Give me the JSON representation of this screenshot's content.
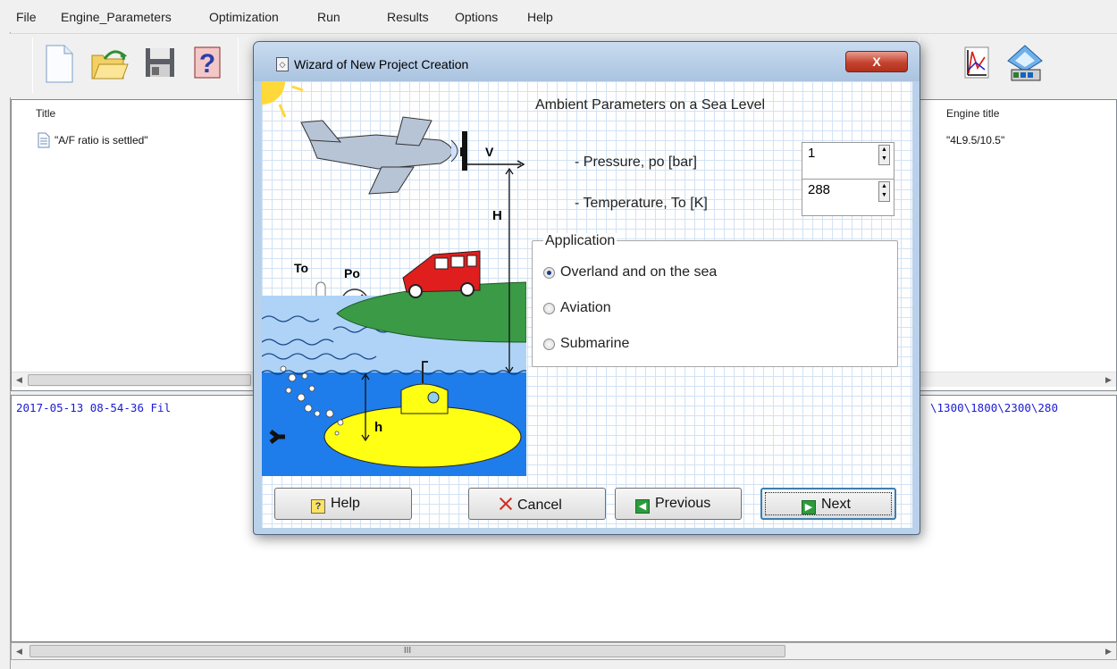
{
  "menu": [
    "File",
    "Engine_Parameters",
    "Optimization",
    "Run",
    "Results",
    "Options",
    "Help"
  ],
  "toolbar_icons": [
    "new-document-icon",
    "open-folder-icon",
    "save-disk-icon",
    "help-icon",
    "chart-icon",
    "video-icon"
  ],
  "list": {
    "columns": [
      "Title",
      "Engine title"
    ],
    "rows": [
      {
        "title": "\"A/F ratio is settled\"",
        "engine_title": "\"4L9.5/10.5\""
      }
    ]
  },
  "log": {
    "line_left": "2017-05-13 08-54-36 Fil",
    "line_right": "\\1300\\1800\\2300\\280"
  },
  "scrollbar": {
    "thumb_grip": "III"
  },
  "dialog": {
    "title": "Wizard of New Project Creation",
    "close_label": "X",
    "section_title": "Ambient Parameters on a Sea Level",
    "pressure": {
      "label": "- Pressure, po [bar]",
      "value": "1"
    },
    "temperature": {
      "label": "- Temperature, To [K]",
      "value": "288"
    },
    "application": {
      "legend": "Application",
      "options": [
        {
          "label": "Overland and on the sea",
          "selected": true
        },
        {
          "label": "Aviation",
          "selected": false
        },
        {
          "label": "Submarine",
          "selected": false
        }
      ]
    },
    "scene_labels": {
      "v": "V",
      "H": "H",
      "To": "To",
      "Po": "Po",
      "h": "h"
    },
    "buttons": {
      "help": "Help",
      "cancel": "Cancel",
      "previous": "Previous",
      "next": "Next"
    },
    "help_icon_glyph": "?",
    "arrow_left_glyph": "◀",
    "arrow_right_glyph": "▶"
  },
  "colors": {
    "log_text": "#1a1ad8",
    "water": "#aed3f7",
    "deep_water": "#1e7dea",
    "land": "#3a9a46",
    "car": "#e01e1e",
    "submarine": "#ffff14"
  }
}
